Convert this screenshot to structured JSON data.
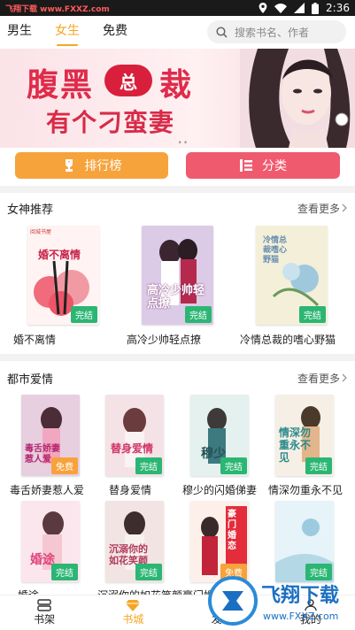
{
  "statusbar": {
    "watermark": "飞翔下载 www.FXXZ.com",
    "time": "2:36"
  },
  "nav": {
    "tabs": [
      "男生",
      "女生",
      "免费"
    ],
    "active": 1
  },
  "search": {
    "placeholder": "搜索书名、作者"
  },
  "banner": {
    "line1": "腹黑",
    "badge": "总",
    "line1b": "裁",
    "line2": "有个刁蛮妻",
    "dots": ".."
  },
  "actions": {
    "rank_label": "排行榜",
    "category_label": "分类"
  },
  "section1": {
    "title": "女神推荐",
    "more": "查看更多",
    "books": [
      {
        "title": "婚不离情",
        "badge": "完结",
        "cover_text": "婚不离情"
      },
      {
        "title": "高冷少帅轻点撩",
        "badge": "完结",
        "cover_text": "高冷少帅轻点撩"
      },
      {
        "title": "冷情总裁的嗜心野猫",
        "badge": "完结",
        "cover_text": "冷情总裁嗜心野猫"
      }
    ]
  },
  "section2": {
    "title": "都市爱情",
    "more": "查看更多",
    "books": [
      {
        "title": "毒舌娇妻惹人爱",
        "badge": "免费",
        "cover_text": "毒舌娇妻惹人爱"
      },
      {
        "title": "替身爱情",
        "badge": "完结",
        "cover_text": "替身爱情"
      },
      {
        "title": "穆少的闪婚俤妻",
        "badge": "完结",
        "cover_text": "穆少"
      },
      {
        "title": "情深勿重永不见",
        "badge": "完结",
        "cover_text": "情深勿重永不见"
      },
      {
        "title": "婚途",
        "badge": "完结",
        "cover_text": "婚途"
      },
      {
        "title": "沉溺你的如花笑颜",
        "badge": "完结",
        "cover_text": "沉溺你的如花笑颜"
      },
      {
        "title": "豪门婚",
        "badge": "免费",
        "cover_text": "豪门婚恋"
      },
      {
        "title": "",
        "badge": "完结",
        "cover_text": ""
      }
    ]
  },
  "bottomnav": {
    "items": [
      "书架",
      "书城",
      "发现",
      "我的"
    ],
    "active": 1
  },
  "watermark_bottom": {
    "text": "飞翔下载",
    "url": "www.FXXZ.com"
  },
  "colors": {
    "accent": "#f5a623",
    "rank_btn": "#f6a33c",
    "cat_btn": "#f05a6e",
    "done_badge": "#2bb673",
    "free_badge": "#f7a23b"
  },
  "publisher_mark": "阅城书屋"
}
